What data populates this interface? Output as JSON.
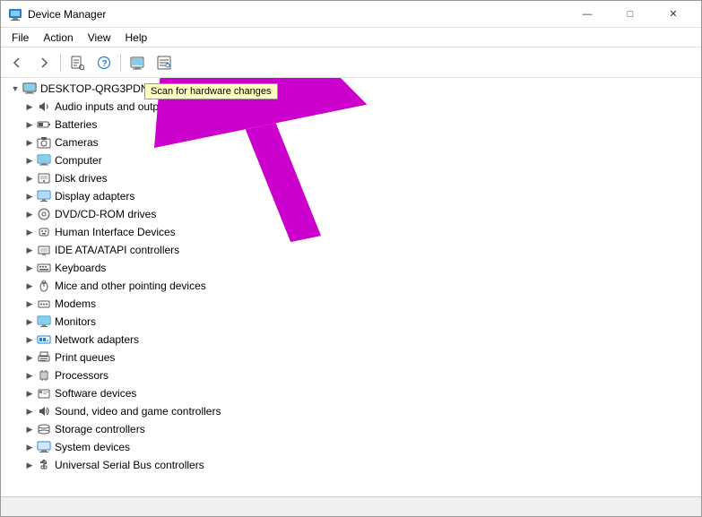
{
  "window": {
    "title": "Device Manager",
    "controls": {
      "minimize": "—",
      "maximize": "□",
      "close": "✕"
    }
  },
  "menubar": {
    "items": [
      "File",
      "Action",
      "View",
      "Help"
    ]
  },
  "toolbar": {
    "buttons": [
      {
        "name": "back",
        "icon": "←"
      },
      {
        "name": "forward",
        "icon": "→"
      },
      {
        "name": "properties",
        "icon": "📄"
      },
      {
        "name": "help",
        "icon": "?"
      },
      {
        "name": "view-device",
        "icon": "📋"
      },
      {
        "name": "monitor",
        "icon": "🖥"
      }
    ]
  },
  "tooltip": {
    "text": "Scan for hardware changes"
  },
  "tree": {
    "root": {
      "label": "DESKTOP-QRG3PDN",
      "expanded": true
    },
    "items": [
      {
        "label": "Audio inputs and outputs",
        "icon": "audio",
        "indent": 1
      },
      {
        "label": "Batteries",
        "icon": "battery",
        "indent": 1
      },
      {
        "label": "Cameras",
        "icon": "camera",
        "indent": 1
      },
      {
        "label": "Computer",
        "icon": "computer",
        "indent": 1
      },
      {
        "label": "Disk drives",
        "icon": "disk",
        "indent": 1
      },
      {
        "label": "Display adapters",
        "icon": "display",
        "indent": 1
      },
      {
        "label": "DVD/CD-ROM drives",
        "icon": "dvd",
        "indent": 1
      },
      {
        "label": "Human Interface Devices",
        "icon": "hid",
        "indent": 1
      },
      {
        "label": "IDE ATA/ATAPI controllers",
        "icon": "ide",
        "indent": 1
      },
      {
        "label": "Keyboards",
        "icon": "keyboard",
        "indent": 1
      },
      {
        "label": "Mice and other pointing devices",
        "icon": "mice",
        "indent": 1
      },
      {
        "label": "Modems",
        "icon": "modem",
        "indent": 1
      },
      {
        "label": "Monitors",
        "icon": "monitor",
        "indent": 1
      },
      {
        "label": "Network adapters",
        "icon": "network",
        "indent": 1
      },
      {
        "label": "Print queues",
        "icon": "print",
        "indent": 1
      },
      {
        "label": "Processors",
        "icon": "processor",
        "indent": 1
      },
      {
        "label": "Software devices",
        "icon": "software",
        "indent": 1
      },
      {
        "label": "Sound, video and game controllers",
        "icon": "sound",
        "indent": 1
      },
      {
        "label": "Storage controllers",
        "icon": "storage",
        "indent": 1
      },
      {
        "label": "System devices",
        "icon": "system",
        "indent": 1
      },
      {
        "label": "Universal Serial Bus controllers",
        "icon": "usb",
        "indent": 1
      }
    ]
  },
  "icons": {
    "audio": "🔊",
    "battery": "🔋",
    "camera": "📷",
    "computer": "💻",
    "disk": "💾",
    "display": "🖥",
    "dvd": "💿",
    "hid": "🎮",
    "ide": "🔌",
    "keyboard": "⌨",
    "mice": "🖱",
    "modem": "📡",
    "monitor": "🖥",
    "network": "🌐",
    "print": "🖨",
    "processor": "⚙",
    "software": "📦",
    "sound": "🎵",
    "storage": "💽",
    "system": "🖥",
    "usb": "🔌"
  }
}
